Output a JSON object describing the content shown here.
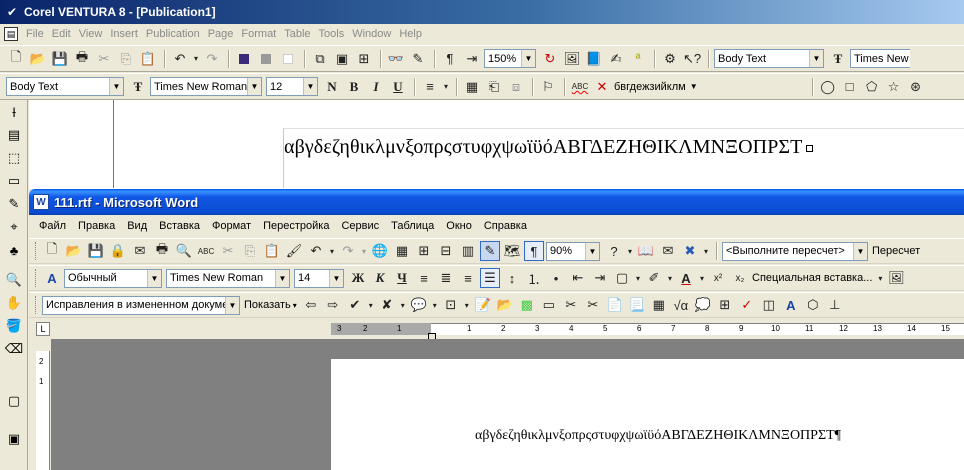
{
  "ventura": {
    "title": "Corel VENTURA 8 - [Publication1]",
    "menu": [
      "File",
      "Edit",
      "View",
      "Insert",
      "Publication",
      "Page",
      "Format",
      "Table",
      "Tools",
      "Window",
      "Help"
    ],
    "zoom": "150%",
    "style_combo_top": "Body Text",
    "font_combo_top": "Times New",
    "style_combo": "Body Text",
    "font_combo": "Times New Roman I",
    "size_combo": "12",
    "bold": "B",
    "italic": "I",
    "underline": "U",
    "bold_alt": "N",
    "spell_sample": "бвгдежзийклм",
    "canvas_text": "αβγδεζηθικλμνξοπρςστυφχψωϊϋόΑΒΓΔΕΖΗΘΙΚΛΜΝΞΟΠΡΣΤ"
  },
  "word": {
    "title": "111.rtf - Microsoft Word",
    "menu": [
      "Файл",
      "Правка",
      "Вид",
      "Вставка",
      "Формат",
      "Перестройка",
      "Сервис",
      "Таблица",
      "Окно",
      "Справка"
    ],
    "zoom": "90%",
    "recalc_combo": "<Выполните пересчет>",
    "recalc_button": "Пересчет",
    "style_combo": "Обычный",
    "font_combo": "Times New Roman",
    "size_combo": "14",
    "bold": "Ж",
    "italic": "К",
    "underline": "Ч",
    "special_paste": "Специальная вставка...",
    "track_combo": "Исправления в измененном документе",
    "show_button": "Показать",
    "ruler_ticks": [
      "3",
      "2",
      "1",
      "1",
      "2",
      "3",
      "4",
      "5",
      "6",
      "7",
      "8",
      "9",
      "10",
      "11",
      "12",
      "13",
      "14",
      "15"
    ],
    "vruler_ticks": [
      "2",
      "1"
    ],
    "page_text": "αβγδεζηθικλμνξοπρςστυφχψωϊϋόΑΒΓΔΕΖΗΘΙΚΛΜΝΞΟΠΡΣΤ¶"
  },
  "colors": {
    "ventura_title_start": "#0a246a",
    "word_title": "#0a4bd0",
    "chrome": "#ece9d8",
    "workspace": "#808080"
  }
}
